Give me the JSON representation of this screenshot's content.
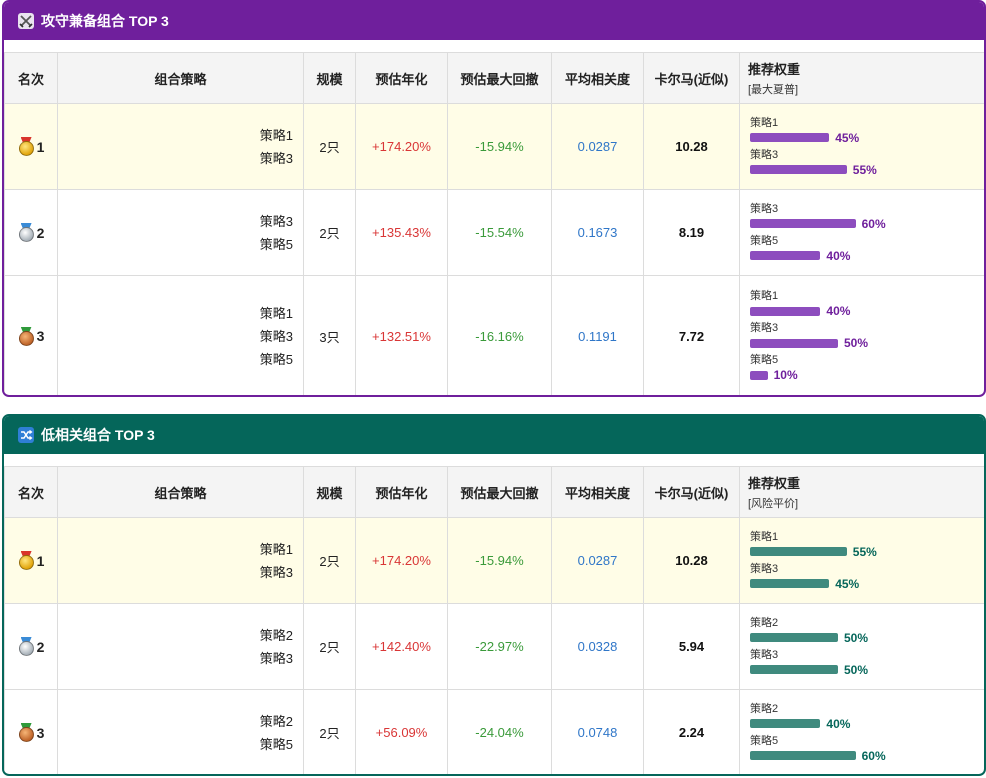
{
  "columns": [
    "名次",
    "组合策略",
    "规模",
    "预估年化",
    "预估最大回撤",
    "平均相关度",
    "卡尔马(近似)",
    "推荐权重"
  ],
  "panels": [
    {
      "title": "攻守兼备组合 TOP 3",
      "icon": "crossed-swords-icon",
      "color": "#6f1f9c",
      "bar_color": "#8d4dbe",
      "pct_color": "#6f1f9c",
      "weight_method": "[最大夏普]",
      "rows": [
        {
          "rank": "1",
          "medal": "gold",
          "strategies": [
            "策略1",
            "策略3"
          ],
          "size": "2只",
          "annual": "+174.20%",
          "drawdown": "-15.94%",
          "corr": "0.0287",
          "calmar": "10.28",
          "weights": [
            {
              "name": "策略1",
              "pct": 45,
              "label": "45%"
            },
            {
              "name": "策略3",
              "pct": 55,
              "label": "55%"
            }
          ]
        },
        {
          "rank": "2",
          "medal": "silver",
          "strategies": [
            "策略3",
            "策略5"
          ],
          "size": "2只",
          "annual": "+135.43%",
          "drawdown": "-15.54%",
          "corr": "0.1673",
          "calmar": "8.19",
          "weights": [
            {
              "name": "策略3",
              "pct": 60,
              "label": "60%"
            },
            {
              "name": "策略5",
              "pct": 40,
              "label": "40%"
            }
          ]
        },
        {
          "rank": "3",
          "medal": "bronze",
          "strategies": [
            "策略1",
            "策略3",
            "策略5"
          ],
          "size": "3只",
          "annual": "+132.51%",
          "drawdown": "-16.16%",
          "corr": "0.1191",
          "calmar": "7.72",
          "weights": [
            {
              "name": "策略1",
              "pct": 40,
              "label": "40%"
            },
            {
              "name": "策略3",
              "pct": 50,
              "label": "50%"
            },
            {
              "name": "策略5",
              "pct": 10,
              "label": "10%"
            }
          ]
        }
      ]
    },
    {
      "title": "低相关组合 TOP 3",
      "icon": "shuffle-icon",
      "color": "#05665a",
      "bar_color": "#3f8a7e",
      "pct_color": "#05665a",
      "weight_method": "[风险平价]",
      "rows": [
        {
          "rank": "1",
          "medal": "gold",
          "strategies": [
            "策略1",
            "策略3"
          ],
          "size": "2只",
          "annual": "+174.20%",
          "drawdown": "-15.94%",
          "corr": "0.0287",
          "calmar": "10.28",
          "weights": [
            {
              "name": "策略1",
              "pct": 55,
              "label": "55%"
            },
            {
              "name": "策略3",
              "pct": 45,
              "label": "45%"
            }
          ]
        },
        {
          "rank": "2",
          "medal": "silver",
          "strategies": [
            "策略2",
            "策略3"
          ],
          "size": "2只",
          "annual": "+142.40%",
          "drawdown": "-22.97%",
          "corr": "0.0328",
          "calmar": "5.94",
          "weights": [
            {
              "name": "策略2",
              "pct": 50,
              "label": "50%"
            },
            {
              "name": "策略3",
              "pct": 50,
              "label": "50%"
            }
          ]
        },
        {
          "rank": "3",
          "medal": "bronze",
          "strategies": [
            "策略2",
            "策略5"
          ],
          "size": "2只",
          "annual": "+56.09%",
          "drawdown": "-24.04%",
          "corr": "0.0748",
          "calmar": "2.24",
          "weights": [
            {
              "name": "策略2",
              "pct": 40,
              "label": "40%"
            },
            {
              "name": "策略5",
              "pct": 60,
              "label": "60%"
            }
          ]
        }
      ]
    }
  ]
}
